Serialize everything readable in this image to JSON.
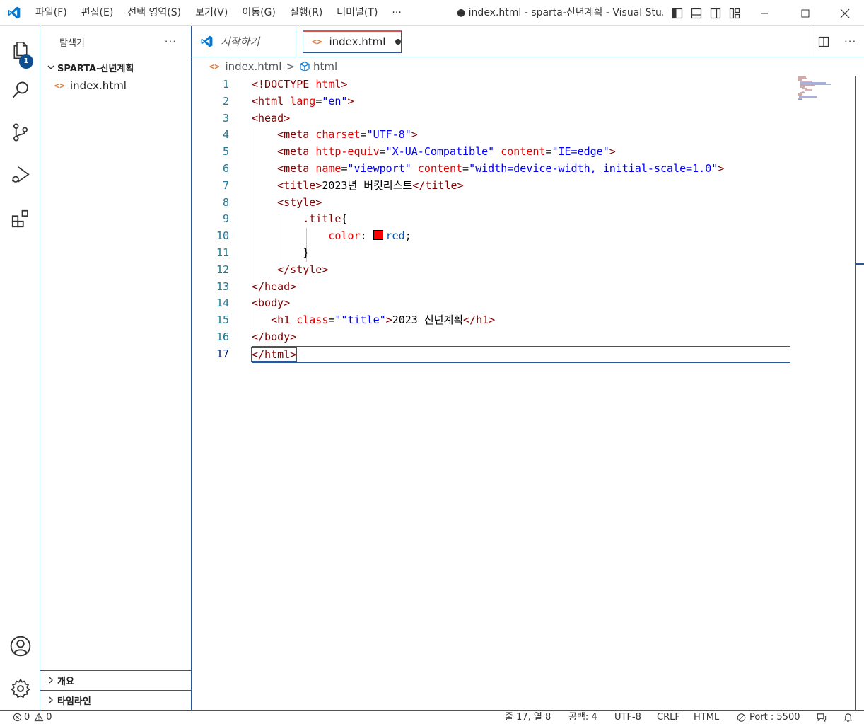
{
  "titlebar": {
    "menu": [
      "파일(F)",
      "편집(E)",
      "선택 영역(S)",
      "보기(V)",
      "이동(G)",
      "실행(R)",
      "터미널(T)"
    ],
    "more": "···",
    "window_title": "● index.html - sparta-신년계획 - Visual Stu..."
  },
  "activity": {
    "explorer_badge": "1"
  },
  "sidebar": {
    "title": "탐색기",
    "more": "···",
    "folder": "SPARTA-신년계획",
    "file_icon": "<>",
    "file": "index.html",
    "outline": "개요",
    "timeline": "타임라인"
  },
  "tabs": {
    "welcome_label": "시작하기",
    "active_icon": "<>",
    "active_label": "index.html",
    "more": "···"
  },
  "breadcrumb": {
    "file_icon": "<>",
    "file": "index.html",
    "sep": ">",
    "symbol": "html"
  },
  "editor": {
    "line_numbers": [
      "1",
      "2",
      "3",
      "4",
      "5",
      "6",
      "7",
      "8",
      "9",
      "10",
      "11",
      "12",
      "13",
      "14",
      "15",
      "16",
      "17"
    ],
    "current_line": 17,
    "colors": {
      "tag": "#800000",
      "attr": "#e50000",
      "value": "#0000ff",
      "swatch": "#ff0000"
    },
    "code": {
      "l1": {
        "a": "<!DOCTYPE ",
        "b": "html",
        "c": ">"
      },
      "l2": {
        "a": "<html ",
        "b": "lang",
        "c": "=",
        "d": "\"en\"",
        "e": ">"
      },
      "l3": {
        "a": "<head>"
      },
      "l4": {
        "a": "<meta ",
        "b": "charset",
        "c": "=",
        "d": "\"UTF-8\"",
        "e": ">"
      },
      "l5": {
        "a": "<meta ",
        "b": "http-equiv",
        "c": "=",
        "d": "\"X-UA-Compatible\"",
        "e": " content",
        "f": "=",
        "g": "\"IE=edge\"",
        "h": ">"
      },
      "l6": {
        "a": "<meta ",
        "b": "name",
        "c": "=",
        "d": "\"viewport\"",
        "e": " content",
        "f": "=",
        "g": "\"width=device-width, initial-scale=1.0\"",
        "h": ">"
      },
      "l7": {
        "a": "<title>",
        "b": "2023년 버킷리스트",
        "c": "</title>"
      },
      "l8": {
        "a": "<style>"
      },
      "l9": {
        "a": ".title",
        "b": "{"
      },
      "l10": {
        "a": "color",
        "b": ": ",
        "c": "red",
        "d": ";"
      },
      "l11": {
        "a": "}"
      },
      "l12": {
        "a": "</style>"
      },
      "l13": {
        "a": "</head>"
      },
      "l14": {
        "a": "<body>"
      },
      "l15": {
        "a": "<h1 ",
        "b": "class",
        "c": "=",
        "d": "\"\"title\"",
        "e": ">",
        "f": "2023 신년계획",
        "g": "</h1>"
      },
      "l16": {
        "a": "</body>"
      },
      "l17": {
        "a": "</html>"
      }
    }
  },
  "statusbar": {
    "errors": "0",
    "warnings": "0",
    "position": "줄 17, 열 8",
    "spaces": "공백: 4",
    "encoding": "UTF-8",
    "eol": "CRLF",
    "language": "HTML",
    "port": "Port : 5500"
  }
}
